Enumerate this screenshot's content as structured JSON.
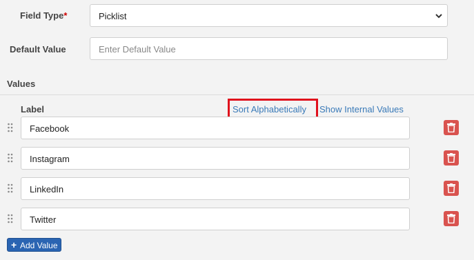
{
  "field_type": {
    "label": "Field Type",
    "required_mark": "*",
    "selected": "Picklist"
  },
  "default_value": {
    "label": "Default Value",
    "placeholder": "Enter Default Value"
  },
  "values_section": {
    "title": "Values",
    "label_header": "Label",
    "sort_link": "Sort Alphabetically",
    "show_internal_link": "Show Internal Values",
    "items": [
      {
        "label": "Facebook"
      },
      {
        "label": "Instagram"
      },
      {
        "label": "LinkedIn"
      },
      {
        "label": "Twitter"
      }
    ],
    "add_button": "Add Value"
  },
  "colors": {
    "highlight": "#e0101c",
    "delete": "#d9534f",
    "link": "#3a7ab8",
    "primary": "#2a64b2"
  },
  "icons": {
    "drag": "drag-handle-icon",
    "delete": "trash-icon",
    "add": "plus-icon",
    "select": "chevron-down-icon"
  }
}
